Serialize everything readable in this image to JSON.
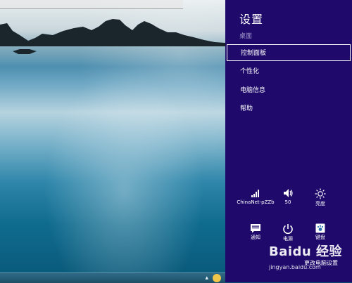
{
  "settings": {
    "title": "设置",
    "context": "桌面",
    "menu_items": [
      {
        "label": "控制面板",
        "selected": true
      },
      {
        "label": "个性化"
      },
      {
        "label": "电脑信息"
      },
      {
        "label": "帮助"
      }
    ],
    "quick_settings": {
      "network": {
        "label": "ChinaNet-pZZb",
        "icon": "wifi-signal-icon"
      },
      "volume": {
        "label": "50",
        "icon": "speaker-icon"
      },
      "brightness": {
        "label": "亮度",
        "icon": "sun-icon"
      },
      "notifications": {
        "label": "通知",
        "icon": "notification-icon"
      },
      "power": {
        "label": "电源",
        "icon": "power-icon"
      },
      "keyboard": {
        "label": "键盘",
        "icon": "keyboard-icon"
      }
    },
    "change_pc_settings": "更改电脑设置"
  },
  "watermark": {
    "logo": "Baidu 经验",
    "url": "jingyan.baidu.com"
  },
  "colors": {
    "panel_bg": "#1f0a6b",
    "muted_text": "#a59bd1",
    "text": "#ffffff"
  }
}
